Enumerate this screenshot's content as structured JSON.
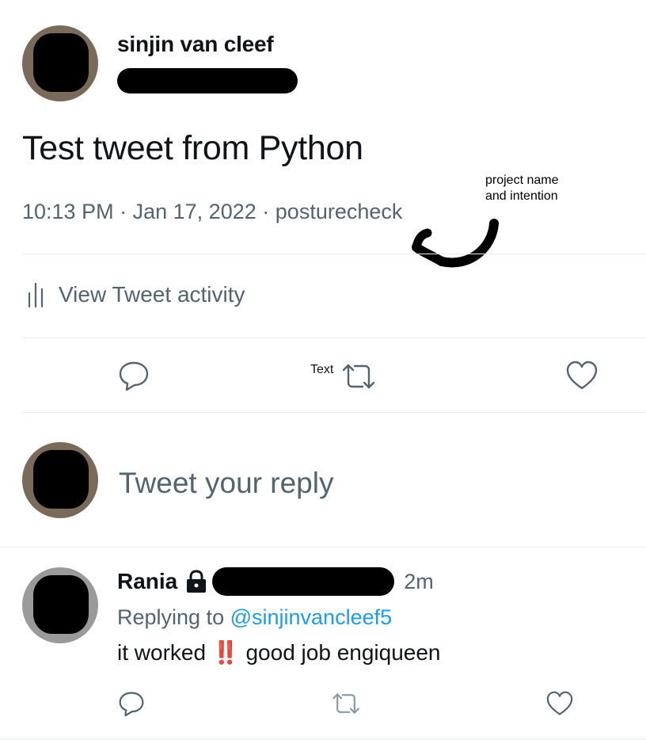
{
  "tweet": {
    "author_name": "sinjin van cleef",
    "text": "Test tweet from Python",
    "time": "10:13 PM",
    "sep1": "·",
    "date": "Jan 17, 2022",
    "sep2": "·",
    "source": "posturecheck"
  },
  "annotation": {
    "line1": "project name",
    "line2": "and intention"
  },
  "activity": {
    "label": "View Tweet activity",
    "icon": "bar-chart-icon"
  },
  "actions": {
    "text_label": "Text",
    "icons": [
      "reply-icon",
      "retweet-icon",
      "like-icon"
    ]
  },
  "composer": {
    "placeholder": "Tweet your reply"
  },
  "reply": {
    "author_name": "Rania",
    "time": "2m",
    "replying_prefix": "Replying to",
    "mention": "@sinjinvancleef5",
    "text_start": "it worked",
    "emoji": "‼️",
    "text_end": "good job engiqueen"
  },
  "colors": {
    "text_primary": "#0f1419",
    "text_secondary": "#536471",
    "link": "#1d9bf0",
    "divider": "#e6ecf0",
    "emoji_red": "#d0201b"
  }
}
